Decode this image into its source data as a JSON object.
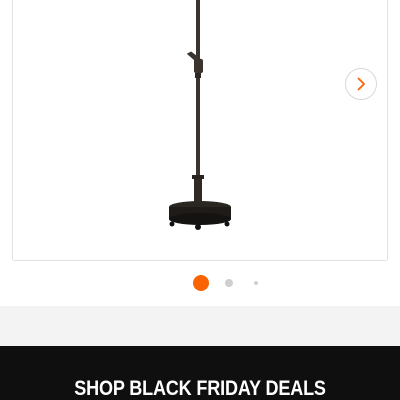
{
  "product_gallery": {
    "image_name": "umbrella-stand-icon",
    "next_icon": "chevron-right-icon",
    "slides": [
      {
        "label": "Slide 1",
        "active": true
      },
      {
        "label": "Slide 2",
        "active": false
      },
      {
        "label": "Slide 3",
        "active": false
      }
    ],
    "accent_color": "#f96302"
  },
  "promo_banner": {
    "label": "SHOP BLACK FRIDAY DEALS",
    "background": "#0f0f0f",
    "text_color": "#ffffff"
  }
}
